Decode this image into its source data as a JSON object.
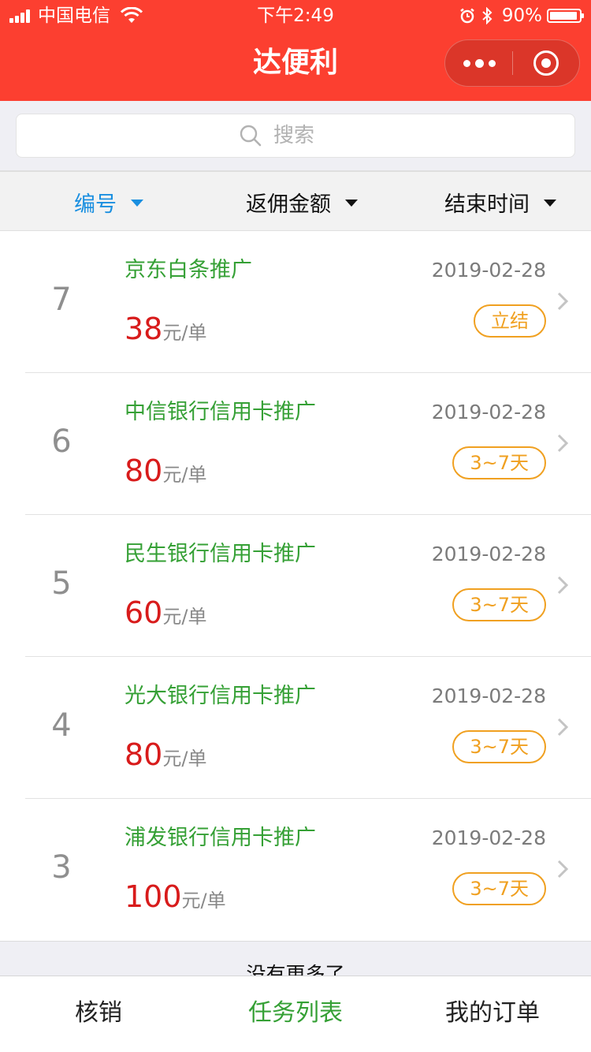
{
  "status_bar": {
    "carrier": "中国电信",
    "time": "下午2:49",
    "battery": "90%",
    "battery_level": 0.9
  },
  "nav": {
    "title": "达便利",
    "more_icon": "more-dots-icon",
    "close_icon": "target-close-icon"
  },
  "search": {
    "placeholder": "搜索",
    "icon": "search-icon"
  },
  "sort": {
    "items": [
      {
        "label": "编号",
        "active": true
      },
      {
        "label": "返佣金额",
        "active": false
      },
      {
        "label": "结束时间",
        "active": false
      }
    ]
  },
  "tasks": [
    {
      "num": "7",
      "title": "京东白条推广",
      "amount": "38",
      "unit": "元/单",
      "date": "2019-02-28",
      "badge": "立结"
    },
    {
      "num": "6",
      "title": "中信银行信用卡推广",
      "amount": "80",
      "unit": "元/单",
      "date": "2019-02-28",
      "badge": "3~7天"
    },
    {
      "num": "5",
      "title": "民生银行信用卡推广",
      "amount": "60",
      "unit": "元/单",
      "date": "2019-02-28",
      "badge": "3~7天"
    },
    {
      "num": "4",
      "title": "光大银行信用卡推广",
      "amount": "80",
      "unit": "元/单",
      "date": "2019-02-28",
      "badge": "3~7天"
    },
    {
      "num": "3",
      "title": "浦发银行信用卡推广",
      "amount": "100",
      "unit": "元/单",
      "date": "2019-02-28",
      "badge": "3~7天"
    }
  ],
  "footer_note": "没有更多了",
  "tabs": [
    {
      "label": "核销",
      "active": false
    },
    {
      "label": "任务列表",
      "active": true
    },
    {
      "label": "我的订单",
      "active": false
    }
  ],
  "colors": {
    "header_red": "#fc3f30",
    "title_green": "#35a035",
    "price_red": "#d81b1b",
    "badge_orange": "#f0a020",
    "sort_active_blue": "#1a8fe0"
  }
}
